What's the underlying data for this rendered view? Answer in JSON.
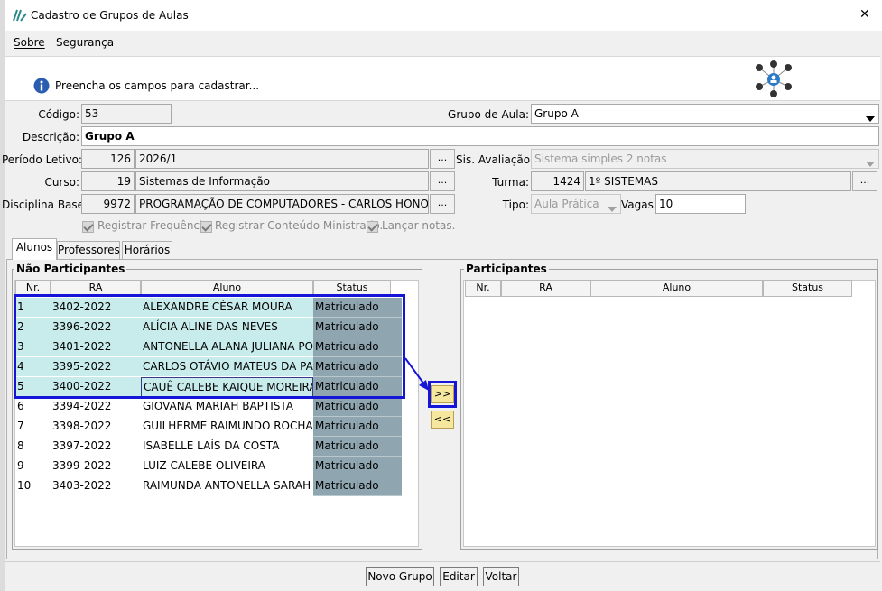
{
  "window": {
    "title": "Cadastro de Grupos de Aulas",
    "close_glyph": "✕"
  },
  "menu": [
    "Sobre",
    "Segurança"
  ],
  "banner": {
    "message": "Preencha os campos para cadastrar..."
  },
  "form": {
    "codigo_label": "Código:",
    "codigo": "53",
    "grupo_aula_label": "Grupo de Aula:",
    "grupo_aula": "Grupo A",
    "descricao_label": "Descrição:",
    "descricao": "Grupo A",
    "periodo_label": "Período Letivo:",
    "periodo_code": "126",
    "periodo_name": "2026/1",
    "sis_aval_label": "Sis. Avaliação:",
    "sis_aval": "Sistema simples 2 notas",
    "curso_label": "Curso:",
    "curso_code": "19",
    "curso_name": "Sistemas de Informação",
    "turma_label": "Turma:",
    "turma_code": "1424",
    "turma_name": "1º SISTEMAS",
    "disciplina_label": "Disciplina Base:",
    "disciplina_code": "9972",
    "disciplina_name": "PROGRAMAÇÃO DE COMPUTADORES - CARLOS HONORINA",
    "tipo_label": "Tipo:",
    "tipo": "Aula Prática",
    "vagas_label": "Vagas:",
    "vagas": "10",
    "dots": "...",
    "checkboxes": [
      "Registrar Frequência.",
      "Registrar Conteúdo Ministrado.",
      "Lançar notas."
    ]
  },
  "tabs": [
    "Alunos",
    "Professores",
    "Horários"
  ],
  "nao_participantes": {
    "title": "Não Participantes",
    "columns": [
      "Nr.",
      "RA",
      "Aluno",
      "Status"
    ],
    "rows": [
      {
        "nr": "1",
        "ra": "3402-2022",
        "aluno": "ALEXANDRE CÉSAR MOURA",
        "status": "Matriculado"
      },
      {
        "nr": "2",
        "ra": "3396-2022",
        "aluno": "ALÍCIA ALINE DAS NEVES",
        "status": "Matriculado"
      },
      {
        "nr": "3",
        "ra": "3401-2022",
        "aluno": "ANTONELLA ALANA JULIANA PO...",
        "status": "Matriculado"
      },
      {
        "nr": "4",
        "ra": "3395-2022",
        "aluno": "CARLOS OTÁVIO MATEUS DA PAZ",
        "status": "Matriculado"
      },
      {
        "nr": "5",
        "ra": "3400-2022",
        "aluno": "CAUÊ CALEBE KAIQUE MOREIRA",
        "status": "Matriculado"
      },
      {
        "nr": "6",
        "ra": "3394-2022",
        "aluno": "GIOVANA MARIAH BAPTISTA",
        "status": "Matriculado"
      },
      {
        "nr": "7",
        "ra": "3398-2022",
        "aluno": "GUILHERME RAIMUNDO ROCHA",
        "status": "Matriculado"
      },
      {
        "nr": "8",
        "ra": "3397-2022",
        "aluno": "ISABELLE LAÍS DA COSTA",
        "status": "Matriculado"
      },
      {
        "nr": "9",
        "ra": "3399-2022",
        "aluno": "LUIZ CALEBE OLIVEIRA",
        "status": "Matriculado"
      },
      {
        "nr": "10",
        "ra": "3403-2022",
        "aluno": "RAIMUNDA ANTONELLA SARAH ...",
        "status": "Matriculado"
      }
    ]
  },
  "participantes": {
    "title": "Participantes",
    "columns": [
      "Nr.",
      "RA",
      "Aluno",
      "Status"
    ]
  },
  "transfer": {
    "add": ">>",
    "remove": "<<"
  },
  "footer": {
    "novo": "Novo Grupo",
    "editar": "Editar",
    "voltar": "Voltar"
  },
  "colors": {
    "selected_row": "#c8ecec",
    "status_cell": "#8fa6b0",
    "highlight": "#1515d8",
    "arrow_button": "#f5e79e"
  }
}
